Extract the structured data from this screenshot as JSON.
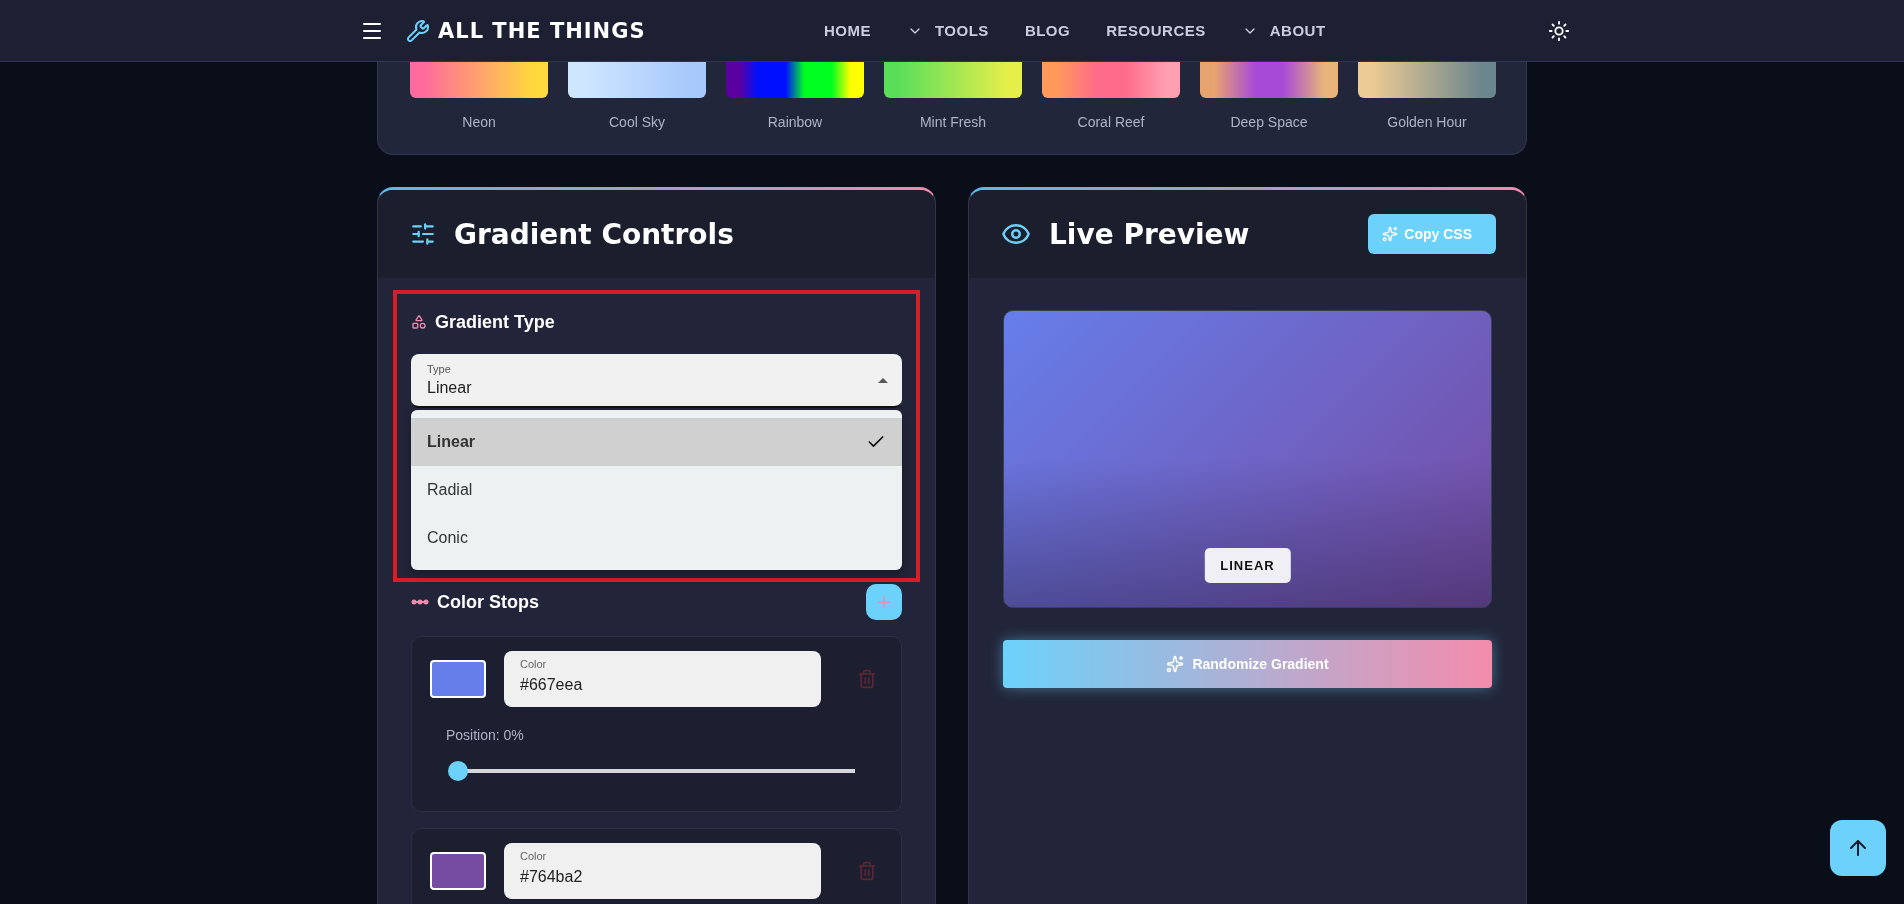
{
  "header": {
    "brand": "ALL THE THINGS",
    "nav": [
      {
        "label": "HOME",
        "has_menu": false
      },
      {
        "label": "TOOLS",
        "has_menu": true
      },
      {
        "label": "BLOG",
        "has_menu": false
      },
      {
        "label": "RESOURCES",
        "has_menu": false
      },
      {
        "label": "ABOUT",
        "has_menu": true
      }
    ]
  },
  "presets": [
    {
      "name": "Neon",
      "gradient": [
        {
          "color": "#ff6b9d"
        },
        {
          "color": "#ffd93d"
        }
      ]
    },
    {
      "name": "Cool Sky",
      "gradient": [
        {
          "color": "#cfe6ff"
        },
        {
          "color": "#a6c8fb"
        }
      ]
    },
    {
      "name": "Rainbow",
      "gradient": [
        {
          "color": "#5a00a0"
        },
        {
          "color": "#0010ff"
        },
        {
          "color": "#00ff20"
        },
        {
          "color": "#ffff00"
        }
      ]
    },
    {
      "name": "Mint Fresh",
      "gradient": [
        {
          "color": "#5ade5a"
        },
        {
          "color": "#e6ef4a"
        }
      ]
    },
    {
      "name": "Coral Reef",
      "gradient": [
        {
          "color": "#ff9a5a"
        },
        {
          "color": "#ff6b8a"
        },
        {
          "color": "#ff9fb0"
        }
      ]
    },
    {
      "name": "Deep Space",
      "gradient": [
        {
          "color": "#e8a46e"
        },
        {
          "color": "#a84ad8"
        },
        {
          "color": "#e8b47a"
        }
      ]
    },
    {
      "name": "Golden Hour",
      "gradient": [
        {
          "color": "#eccb94"
        },
        {
          "color": "#6c868e"
        }
      ]
    }
  ],
  "controls": {
    "title": "Gradient Controls",
    "type_section": {
      "title": "Gradient Type",
      "select": {
        "label": "Type",
        "value": "Linear",
        "expanded": true
      },
      "options": [
        {
          "label": "Linear",
          "selected": true
        },
        {
          "label": "Radial",
          "selected": false
        },
        {
          "label": "Conic",
          "selected": false
        }
      ]
    },
    "stops_section": {
      "title": "Color Stops",
      "stops": [
        {
          "label": "Color",
          "value": "#667eea",
          "color": "#667eea",
          "position_label": "Position: 0%",
          "level": 0
        },
        {
          "label": "Color",
          "value": "#764ba2",
          "color": "#764ba2"
        }
      ]
    }
  },
  "preview": {
    "title": "Live Preview",
    "copy_button": "Copy CSS",
    "badge": "LINEAR",
    "randomize_button": "Randomize Gradient"
  }
}
